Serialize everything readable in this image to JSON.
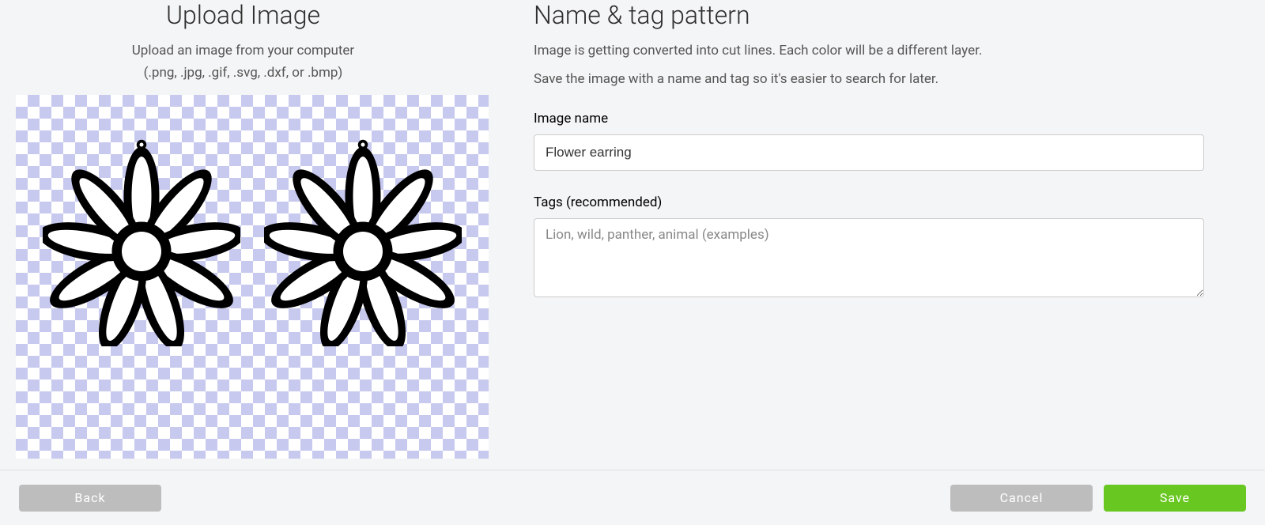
{
  "left": {
    "title": "Upload Image",
    "subtitle": "Upload an image from your computer",
    "formats": "(.png, .jpg, .gif, .svg, .dxf, or .bmp)"
  },
  "right": {
    "title": "Name & tag pattern",
    "desc1": "Image is getting converted into cut lines. Each color will be a different layer.",
    "desc2": "Save the image with a name and tag so it's easier to search for later.",
    "image_name_label": "Image name",
    "image_name_value": "Flower earring",
    "tags_label": "Tags (recommended)",
    "tags_value": "",
    "tags_placeholder": "Lion, wild, panther, animal (examples)"
  },
  "footer": {
    "back": "Back",
    "cancel": "Cancel",
    "save": "Save"
  }
}
